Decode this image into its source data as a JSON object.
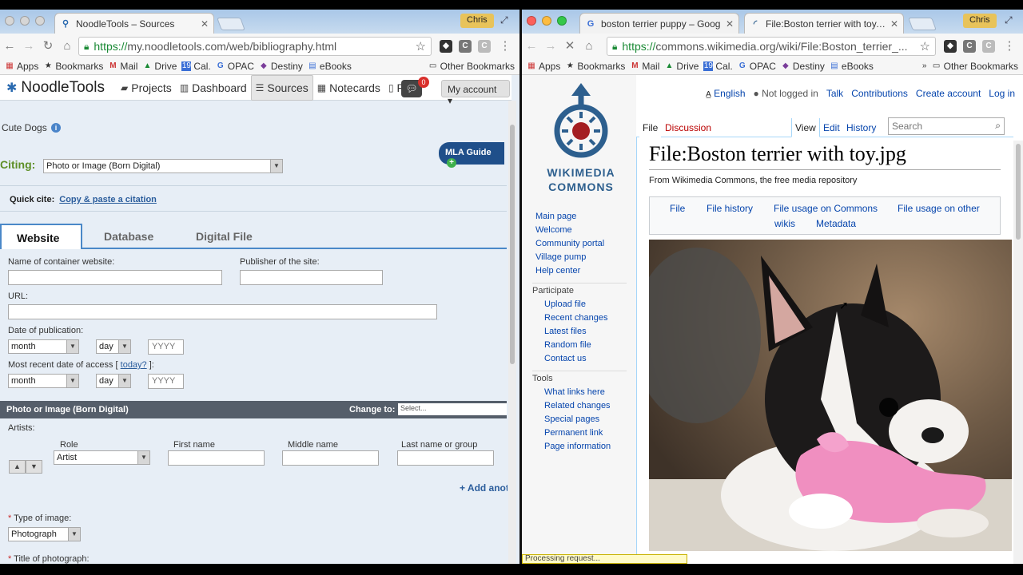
{
  "left": {
    "tab_title": "NoodleTools – Sources",
    "profile": "Chris",
    "url_scheme": "https://",
    "url_rest": "my.noodletools.com/web/bibliography.html",
    "bookmarks": [
      "Apps",
      "Bookmarks",
      "Mail",
      "Drive",
      "Cal.",
      "OPAC",
      "Destiny",
      "eBooks"
    ],
    "other_bookmarks": "Other Bookmarks",
    "nav": {
      "brand": "NoodleTools",
      "items": [
        "Projects",
        "Dashboard",
        "Sources",
        "Notecards",
        "Paper"
      ],
      "notif_count": "0",
      "account": "My account ▾"
    },
    "project": "Cute Dogs",
    "mla_guide": "MLA Guide",
    "citing_label": "Citing:",
    "citing_value": "Photo or Image (Born Digital)",
    "quick_cite_label": "Quick cite:",
    "quick_cite_link": "Copy & paste a citation",
    "tabs": [
      "Website",
      "Database",
      "Digital File"
    ],
    "form": {
      "container_label": "Name of container website:",
      "publisher_label": "Publisher of the site:",
      "url_label": "URL:",
      "pubdate_label": "Date of publication:",
      "month": "month",
      "day": "day",
      "year_ph": "YYYY",
      "access_label_pre": "Most recent date of access [",
      "access_today": "today?",
      "access_label_post": "]:"
    },
    "section": {
      "title": "Photo or Image (Born Digital)",
      "change_to": "Change to:",
      "select_ph": "Select..."
    },
    "artists": {
      "label": "Artists:",
      "cols": [
        "Role",
        "First name",
        "Middle name",
        "Last name or group"
      ],
      "role_value": "Artist",
      "add": "+ Add anot"
    },
    "type_label": "Type of image:",
    "type_value": "Photograph",
    "title_label": "Title of photograph:"
  },
  "right": {
    "tabs": [
      "boston terrier puppy – Goog",
      "File:Boston terrier with toy.jpg"
    ],
    "profile": "Chris",
    "url_scheme": "https://",
    "url_rest": "commons.wikimedia.org/wiki/File:Boston_terrier_...",
    "bookmarks": [
      "Apps",
      "Bookmarks",
      "Mail",
      "Drive",
      "Cal.",
      "OPAC",
      "Destiny",
      "eBooks"
    ],
    "other_bookmarks": "Other Bookmarks",
    "logo_text_1": "WIKIMEDIA",
    "logo_text_2": "COMMONS",
    "personal": [
      "English",
      "Not logged in",
      "Talk",
      "Contributions",
      "Create account",
      "Log in"
    ],
    "page_tabs": [
      "File",
      "Discussion",
      "View",
      "Edit",
      "History"
    ],
    "search_ph": "Search",
    "sidebar": {
      "main": [
        "Main page",
        "Welcome",
        "Community portal",
        "Village pump",
        "Help center"
      ],
      "participate_title": "Participate",
      "participate": [
        "Upload file",
        "Recent changes",
        "Latest files",
        "Random file",
        "Contact us"
      ],
      "tools_title": "Tools",
      "tools": [
        "What links here",
        "Related changes",
        "Special pages",
        "Permanent link",
        "Page information"
      ]
    },
    "title": "File:Boston terrier with toy.jpg",
    "from": "From Wikimedia Commons, the free media repository",
    "filenav": [
      "File",
      "File history",
      "File usage on Commons",
      "File usage on other",
      "wikis",
      "Metadata"
    ],
    "status": "Processing request..."
  }
}
